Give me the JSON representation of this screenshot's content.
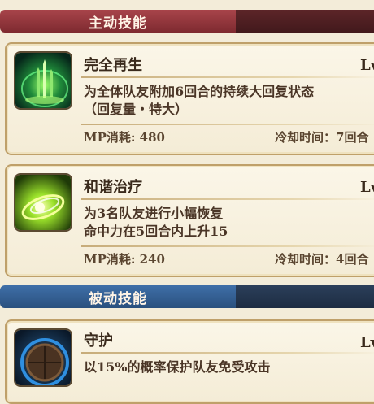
{
  "sections": {
    "active_title": "主动技能",
    "passive_title": "被动技能"
  },
  "skills": [
    {
      "name": "完全再生",
      "level": "Lv",
      "desc_line1": "为全体队友附加6回合的持续大回复状态",
      "desc_line2": "（回复量・特大）",
      "mp": "MP消耗: 480",
      "cooldown": "冷却时间：7回合",
      "icon": "regeneration-icon"
    },
    {
      "name": "和谐治疗",
      "level": "Lv",
      "desc_line1": "为3名队友进行小幅恢复",
      "desc_line2": "命中力在5回合内上升15",
      "mp": "MP消耗: 240",
      "cooldown": "冷却时间：4回合",
      "icon": "harmony-heal-icon"
    },
    {
      "name": "守护",
      "level": "Lv",
      "desc_line1": "以15%的概率保护队友免受攻击",
      "icon": "shield-icon"
    }
  ],
  "colors": {
    "active_bar": "#8f3338",
    "passive_bar": "#345f94",
    "card_border": "#bfa06a"
  }
}
